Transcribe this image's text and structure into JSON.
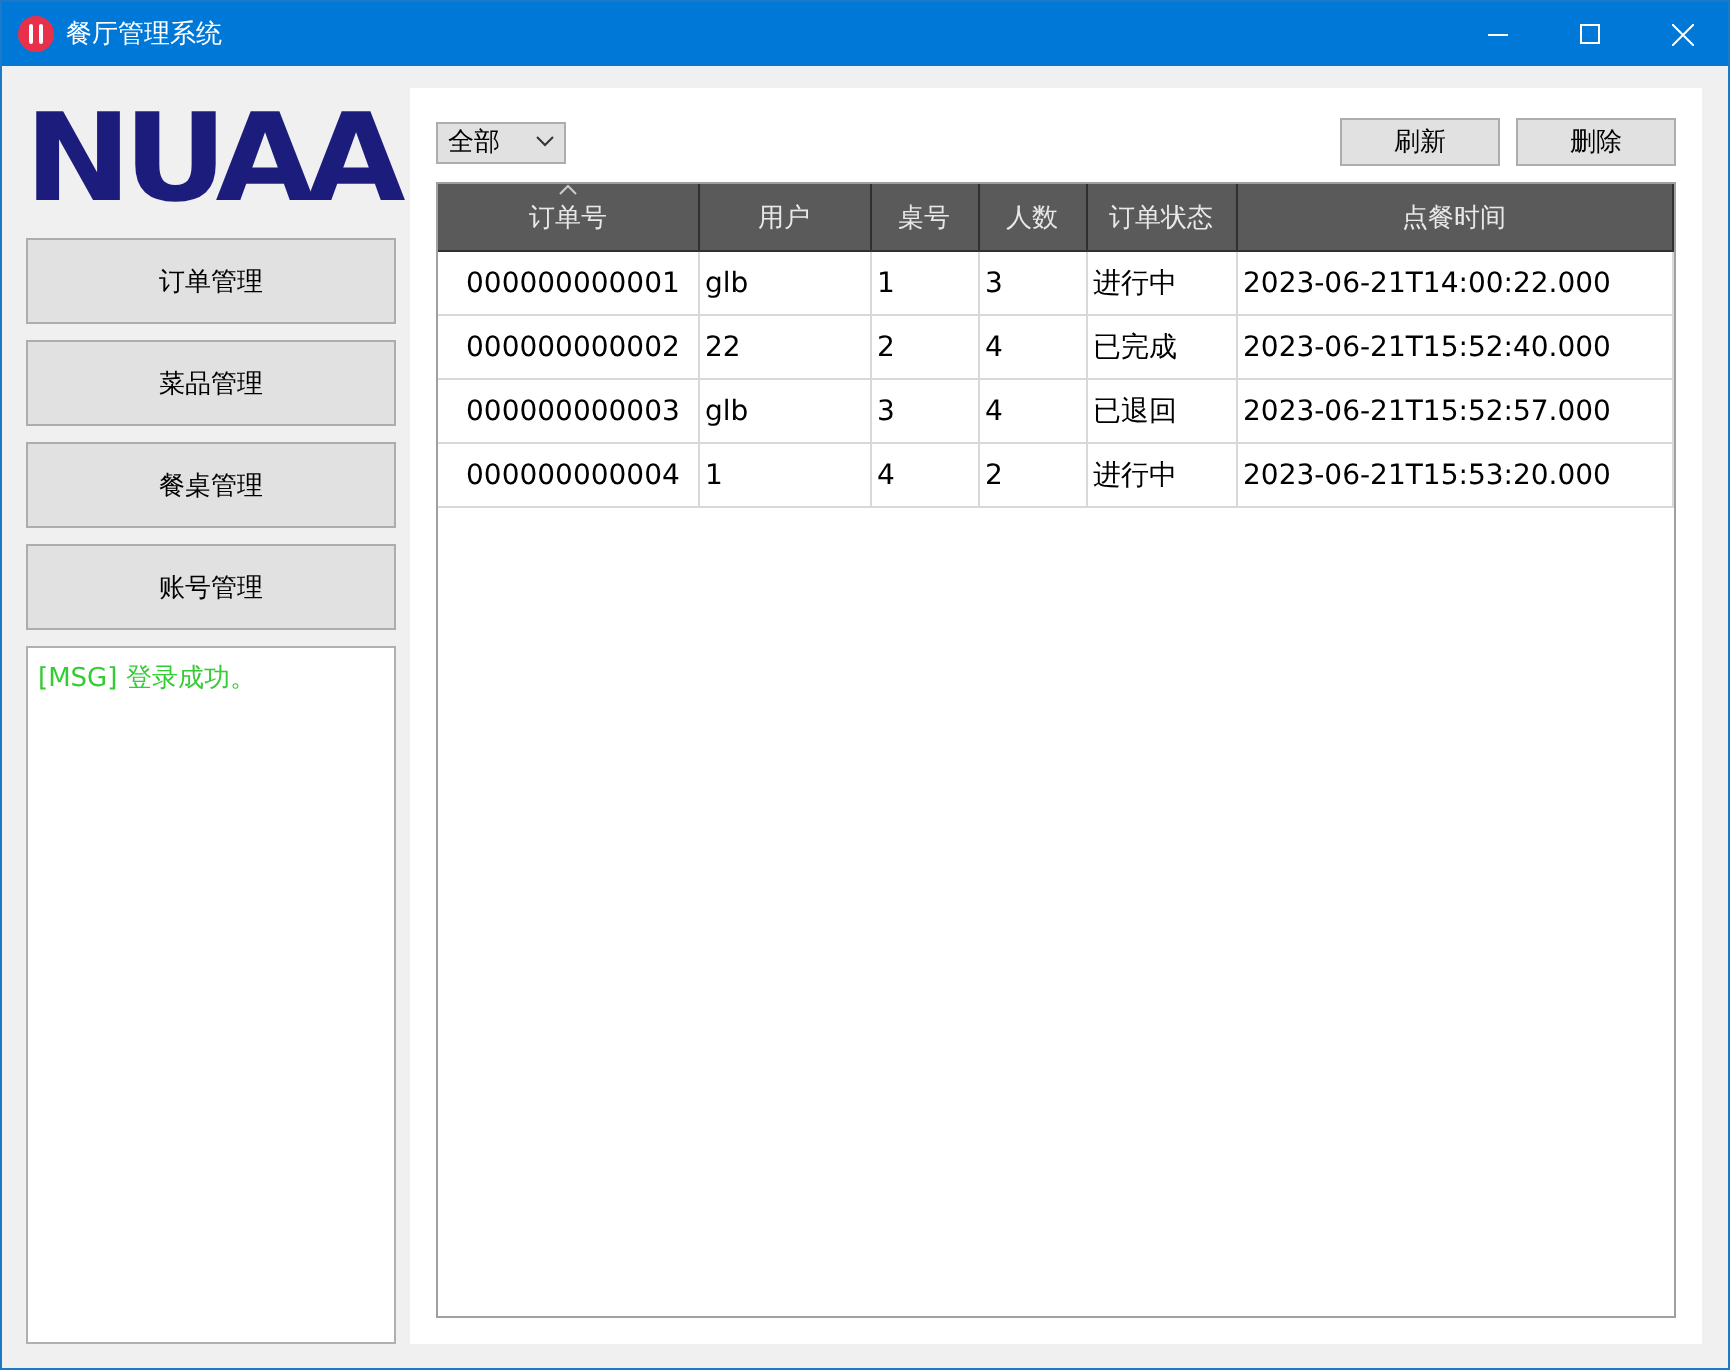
{
  "window": {
    "title": "餐厅管理系统"
  },
  "logo": {
    "text": "NUAA"
  },
  "nav": [
    {
      "label": "订单管理"
    },
    {
      "label": "菜品管理"
    },
    {
      "label": "餐桌管理"
    },
    {
      "label": "账号管理"
    }
  ],
  "log": [
    {
      "text": "[MSG] 登录成功。",
      "color": "#33cc33"
    }
  ],
  "filter": {
    "value": "全部"
  },
  "buttons": [
    {
      "label": "刷新"
    },
    {
      "label": "删除"
    }
  ],
  "table": {
    "columns": [
      {
        "label": "订单号",
        "sorted": true
      },
      {
        "label": "用户",
        "sorted": false
      },
      {
        "label": "桌号",
        "sorted": false
      },
      {
        "label": "人数",
        "sorted": false
      },
      {
        "label": "订单状态",
        "sorted": false
      },
      {
        "label": "点餐时间",
        "sorted": false
      }
    ],
    "rows": [
      [
        "000000000001",
        "glb",
        "1",
        "3",
        "进行中",
        "2023-06-21T14:00:22.000"
      ],
      [
        "000000000002",
        "22",
        "2",
        "4",
        "已完成",
        "2023-06-21T15:52:40.000"
      ],
      [
        "000000000003",
        "glb",
        "3",
        "4",
        "已退回",
        "2023-06-21T15:52:57.000"
      ],
      [
        "000000000004",
        "1",
        "4",
        "2",
        "进行中",
        "2023-06-21T15:53:20.000"
      ]
    ]
  }
}
